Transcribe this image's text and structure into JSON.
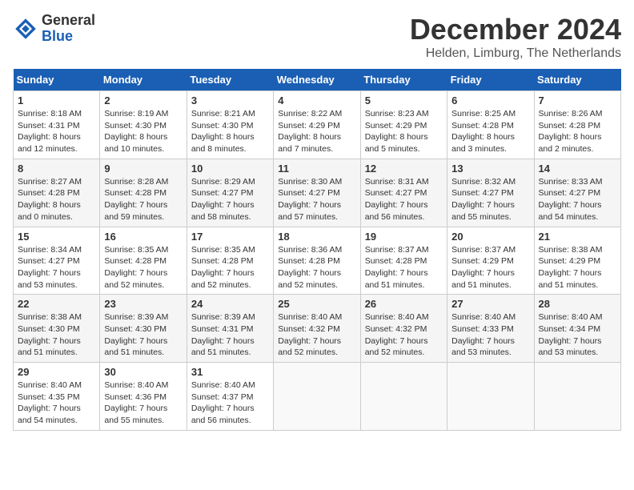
{
  "header": {
    "logo": {
      "line1": "General",
      "line2": "Blue"
    },
    "title": "December 2024",
    "location": "Helden, Limburg, The Netherlands"
  },
  "calendar": {
    "days_of_week": [
      "Sunday",
      "Monday",
      "Tuesday",
      "Wednesday",
      "Thursday",
      "Friday",
      "Saturday"
    ],
    "weeks": [
      [
        {
          "day": "1",
          "info": "Sunrise: 8:18 AM\nSunset: 4:31 PM\nDaylight: 8 hours\nand 12 minutes."
        },
        {
          "day": "2",
          "info": "Sunrise: 8:19 AM\nSunset: 4:30 PM\nDaylight: 8 hours\nand 10 minutes."
        },
        {
          "day": "3",
          "info": "Sunrise: 8:21 AM\nSunset: 4:30 PM\nDaylight: 8 hours\nand 8 minutes."
        },
        {
          "day": "4",
          "info": "Sunrise: 8:22 AM\nSunset: 4:29 PM\nDaylight: 8 hours\nand 7 minutes."
        },
        {
          "day": "5",
          "info": "Sunrise: 8:23 AM\nSunset: 4:29 PM\nDaylight: 8 hours\nand 5 minutes."
        },
        {
          "day": "6",
          "info": "Sunrise: 8:25 AM\nSunset: 4:28 PM\nDaylight: 8 hours\nand 3 minutes."
        },
        {
          "day": "7",
          "info": "Sunrise: 8:26 AM\nSunset: 4:28 PM\nDaylight: 8 hours\nand 2 minutes."
        }
      ],
      [
        {
          "day": "8",
          "info": "Sunrise: 8:27 AM\nSunset: 4:28 PM\nDaylight: 8 hours\nand 0 minutes."
        },
        {
          "day": "9",
          "info": "Sunrise: 8:28 AM\nSunset: 4:28 PM\nDaylight: 7 hours\nand 59 minutes."
        },
        {
          "day": "10",
          "info": "Sunrise: 8:29 AM\nSunset: 4:27 PM\nDaylight: 7 hours\nand 58 minutes."
        },
        {
          "day": "11",
          "info": "Sunrise: 8:30 AM\nSunset: 4:27 PM\nDaylight: 7 hours\nand 57 minutes."
        },
        {
          "day": "12",
          "info": "Sunrise: 8:31 AM\nSunset: 4:27 PM\nDaylight: 7 hours\nand 56 minutes."
        },
        {
          "day": "13",
          "info": "Sunrise: 8:32 AM\nSunset: 4:27 PM\nDaylight: 7 hours\nand 55 minutes."
        },
        {
          "day": "14",
          "info": "Sunrise: 8:33 AM\nSunset: 4:27 PM\nDaylight: 7 hours\nand 54 minutes."
        }
      ],
      [
        {
          "day": "15",
          "info": "Sunrise: 8:34 AM\nSunset: 4:27 PM\nDaylight: 7 hours\nand 53 minutes."
        },
        {
          "day": "16",
          "info": "Sunrise: 8:35 AM\nSunset: 4:28 PM\nDaylight: 7 hours\nand 52 minutes."
        },
        {
          "day": "17",
          "info": "Sunrise: 8:35 AM\nSunset: 4:28 PM\nDaylight: 7 hours\nand 52 minutes."
        },
        {
          "day": "18",
          "info": "Sunrise: 8:36 AM\nSunset: 4:28 PM\nDaylight: 7 hours\nand 52 minutes."
        },
        {
          "day": "19",
          "info": "Sunrise: 8:37 AM\nSunset: 4:28 PM\nDaylight: 7 hours\nand 51 minutes."
        },
        {
          "day": "20",
          "info": "Sunrise: 8:37 AM\nSunset: 4:29 PM\nDaylight: 7 hours\nand 51 minutes."
        },
        {
          "day": "21",
          "info": "Sunrise: 8:38 AM\nSunset: 4:29 PM\nDaylight: 7 hours\nand 51 minutes."
        }
      ],
      [
        {
          "day": "22",
          "info": "Sunrise: 8:38 AM\nSunset: 4:30 PM\nDaylight: 7 hours\nand 51 minutes."
        },
        {
          "day": "23",
          "info": "Sunrise: 8:39 AM\nSunset: 4:30 PM\nDaylight: 7 hours\nand 51 minutes."
        },
        {
          "day": "24",
          "info": "Sunrise: 8:39 AM\nSunset: 4:31 PM\nDaylight: 7 hours\nand 51 minutes."
        },
        {
          "day": "25",
          "info": "Sunrise: 8:40 AM\nSunset: 4:32 PM\nDaylight: 7 hours\nand 52 minutes."
        },
        {
          "day": "26",
          "info": "Sunrise: 8:40 AM\nSunset: 4:32 PM\nDaylight: 7 hours\nand 52 minutes."
        },
        {
          "day": "27",
          "info": "Sunrise: 8:40 AM\nSunset: 4:33 PM\nDaylight: 7 hours\nand 53 minutes."
        },
        {
          "day": "28",
          "info": "Sunrise: 8:40 AM\nSunset: 4:34 PM\nDaylight: 7 hours\nand 53 minutes."
        }
      ],
      [
        {
          "day": "29",
          "info": "Sunrise: 8:40 AM\nSunset: 4:35 PM\nDaylight: 7 hours\nand 54 minutes."
        },
        {
          "day": "30",
          "info": "Sunrise: 8:40 AM\nSunset: 4:36 PM\nDaylight: 7 hours\nand 55 minutes."
        },
        {
          "day": "31",
          "info": "Sunrise: 8:40 AM\nSunset: 4:37 PM\nDaylight: 7 hours\nand 56 minutes."
        },
        {
          "day": "",
          "info": ""
        },
        {
          "day": "",
          "info": ""
        },
        {
          "day": "",
          "info": ""
        },
        {
          "day": "",
          "info": ""
        }
      ]
    ]
  }
}
